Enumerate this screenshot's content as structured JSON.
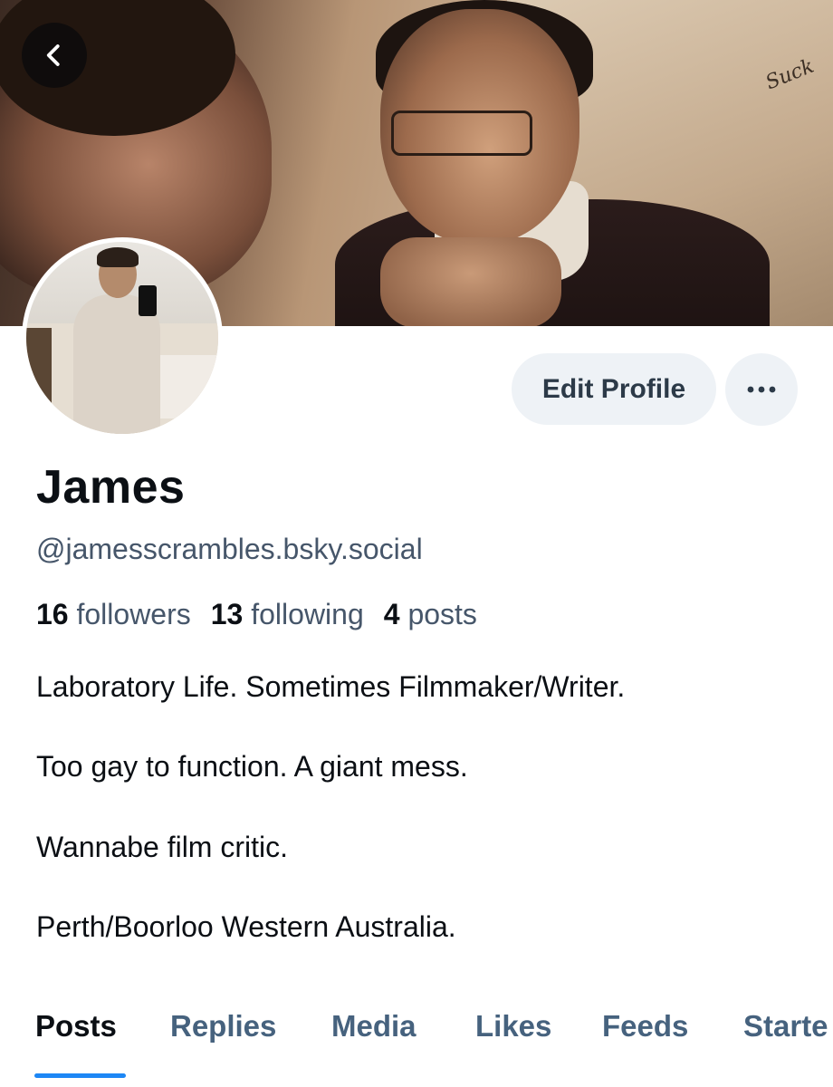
{
  "header": {
    "back_icon": "chevron-left-icon",
    "banner_caption": "Suck"
  },
  "actions": {
    "edit_profile_label": "Edit Profile",
    "more_icon": "ellipsis-icon"
  },
  "profile": {
    "display_name": "James",
    "handle": "@jamesscrambles.bsky.social",
    "stats": {
      "followers_count": "16",
      "followers_label": "followers",
      "following_count": "13",
      "following_label": "following",
      "posts_count": "4",
      "posts_label": "posts"
    },
    "bio": [
      "Laboratory Life. Sometimes Filmmaker/Writer.",
      "Too gay to function. A giant mess.",
      "Wannabe film critic.",
      "Perth/Boorloo Western Australia."
    ]
  },
  "tabs": [
    {
      "label": "Posts",
      "active": true
    },
    {
      "label": "Replies",
      "active": false
    },
    {
      "label": "Media",
      "active": false
    },
    {
      "label": "Likes",
      "active": false
    },
    {
      "label": "Feeds",
      "active": false
    },
    {
      "label": "Starte",
      "active": false
    }
  ],
  "colors": {
    "accent": "#1d87f5",
    "muted_text": "#46566a",
    "button_bg": "#eef2f6"
  }
}
